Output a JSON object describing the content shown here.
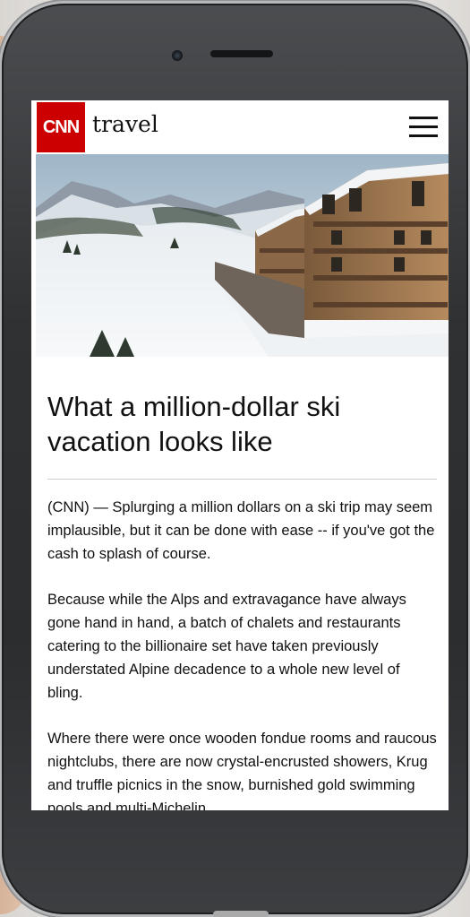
{
  "brand": {
    "logo_text": "CNN",
    "section": "travel",
    "accent": "#cc0000"
  },
  "menu_icon": "hamburger-menu-icon",
  "hero_image": "snowy-alpine-ski-chalet-photo",
  "article": {
    "headline": "What a million-dollar ski vacation looks like",
    "paragraphs": [
      "(CNN) — Splurging a million dollars on a ski trip may seem implausible, but it can be done with ease -- if you've got the cash to splash of course.",
      "Because while the Alps and extravagance have always gone hand in hand, a batch of chalets and restaurants catering to the billionaire set have taken previously understated Alpine decadence to a whole new level of bling.",
      "Where there were once wooden fondue rooms and raucous nightclubs, there are now crystal-encrusted showers, Krug and truffle picnics in the snow, burnished gold swimming pools and multi-Michelin"
    ]
  }
}
